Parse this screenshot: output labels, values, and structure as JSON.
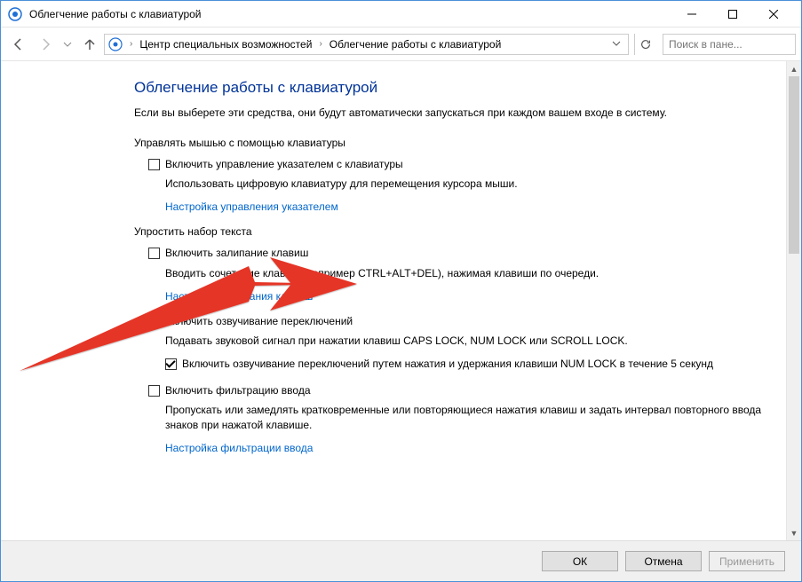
{
  "window": {
    "title": "Облегчение работы с клавиатурой"
  },
  "breadcrumb": {
    "seg1": "Центр специальных возможностей",
    "seg2": "Облегчение работы с клавиатурой"
  },
  "search": {
    "placeholder": "Поиск в пане..."
  },
  "page": {
    "title": "Облегчение работы с клавиатурой",
    "intro": "Если вы выберете эти средства, они будут автоматически запускаться при каждом вашем входе в систему."
  },
  "sec1": {
    "label": "Управлять мышью с помощью клавиатуры",
    "chk1": "Включить управление указателем с клавиатуры",
    "desc1": "Использовать цифровую клавиатуру для перемещения курсора мыши.",
    "link1": "Настройка управления указателем"
  },
  "sec2": {
    "label": "Упростить набор текста",
    "chk1": "Включить залипание клавиш",
    "desc1": "Вводить сочетание клавиш (например CTRL+ALT+DEL), нажимая клавиши по очереди.",
    "link1": "Настройка залипания клавиш",
    "chk2": "Включить озвучивание переключений",
    "desc2": "Подавать звуковой сигнал при нажатии клавиш CAPS LOCK, NUM LOCK или SCROLL LOCK.",
    "sub_chk": "Включить озвучивание переключений путем нажатия и удержания клавиши NUM LOCK в течение 5 секунд",
    "chk3": "Включить фильтрацию ввода",
    "desc3": "Пропускать или замедлять кратковременные или повторяющиеся нажатия клавиш и задать интервал повторного ввода знаков при нажатой клавише.",
    "link3": "Настройка фильтрации ввода"
  },
  "buttons": {
    "ok": "ОК",
    "cancel": "Отмена",
    "apply": "Применить"
  }
}
